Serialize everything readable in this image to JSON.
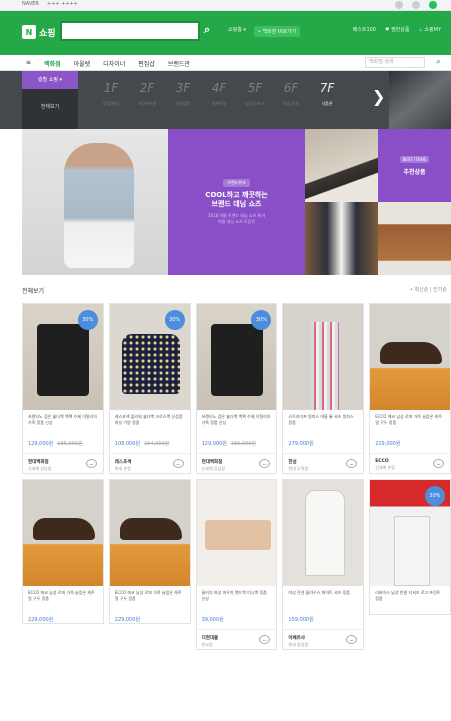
{
  "topbar": {
    "left_items": [
      "NAVER",
      "+++ ++++"
    ]
  },
  "header": {
    "logo_badge": "N",
    "logo_text": "쇼핑",
    "search_placeholder": "",
    "search_icon": "search-icon",
    "links": [
      "쇼핑홈 ▾",
      "• 백화점 바로가기"
    ],
    "right_links": [
      "베스트100",
      "♥ 찜한상품",
      "⊥ 쇼핑MY"
    ]
  },
  "catnav": {
    "items": [
      "≡",
      "백화점",
      "아울렛",
      "디자이너",
      "편집샵",
      "브랜드관"
    ],
    "search_placeholder": "백화점 검색"
  },
  "floorbar": {
    "tag": "층별 쇼핑 ▾",
    "current": "전체보기",
    "floors": [
      {
        "n": "1F",
        "s": "명품/화장"
      },
      {
        "n": "2F",
        "s": "여성캐주얼"
      },
      {
        "n": "3F",
        "s": "여성정장"
      },
      {
        "n": "4F",
        "s": "영캐주얼"
      },
      {
        "n": "5F",
        "s": "남성/스포츠"
      },
      {
        "n": "6F",
        "s": "아동/가정"
      },
      {
        "n": "7F",
        "s": "식품관"
      }
    ],
    "arrow": "❯"
  },
  "banner": {
    "label": "브랜드위크",
    "title": "COOL하고 깨끗하는\n브랜드 데님 쇼츠",
    "sub": "2018 여름 트렌드 데님 쇼츠 특가\n여름 데님 쇼츠 모음전",
    "rec_label": "BEST ITEMS",
    "rec_title": "추천상품"
  },
  "section": {
    "title": "전체보기",
    "sort": "• 최신순 | 인기순"
  },
  "columns": [
    [
      {
        "img": "img-bag",
        "badge": "30%",
        "text": "쏘렌티노 검은 숄더백 백팩 수제 이탈리아 가죽 정품 신상",
        "price": "129,000원",
        "orig": "185,000원",
        "shop": "현대백화점",
        "shop_sub": "신세계 강남점"
      },
      {
        "img": "img-shoe",
        "badge": "",
        "text": "ECCO 에코 남성 로퍼 가죽 슬립온 캐주얼 구두 정품",
        "price": "229,000원",
        "orig": "",
        "shop": "",
        "shop_sub": ""
      }
    ],
    [
      {
        "img": "img-floral",
        "badge": "30%",
        "text": "레스포색 플라워 숄더백 크로스백 신상품 여성 가방 정품",
        "price": "108,000원",
        "orig": "154,000원",
        "shop": "레스포색",
        "shop_sub": "롯데 본점"
      },
      {
        "img": "img-shoe",
        "badge": "",
        "text": "ECCO 에코 남성 로퍼 가죽 슬립온 캐주얼 구두 정품",
        "price": "229,000원",
        "orig": "",
        "shop": "",
        "shop_sub": ""
      }
    ],
    [
      {
        "img": "img-bag",
        "badge": "30%",
        "text": "쏘렌티노 검은 숄더백 백팩 수제 이탈리아 가죽 정품 신상",
        "price": "129,000원",
        "orig": "185,000원",
        "shop": "현대백화점",
        "shop_sub": "신세계 강남점"
      },
      {
        "img": "img-clutch",
        "badge": "",
        "text": "클러치 여성 파우치 핸드백 미니백 정품 신상",
        "price": "39,000원",
        "orig": "",
        "shop": "더현대몰",
        "shop_sub": "판교점"
      }
    ],
    [
      {
        "img": "img-skirt",
        "badge": "",
        "text": "스트라이프 원피스 여름 롱 셔츠 원피스 정품",
        "price": "279,000원",
        "orig": "",
        "shop": "한섬",
        "shop_sub": "현대 무역점"
      },
      {
        "img": "img-blouse",
        "badge": "",
        "text": "여성 린넨 블라우스 화이트 셔츠 정품",
        "price": "159,000원",
        "orig": "",
        "shop": "아페르샤",
        "shop_sub": "롯데 잠실점"
      }
    ],
    [
      {
        "img": "img-shoe",
        "badge": "",
        "text": "ECCO 에코 남성 로퍼 가죽 슬립온 캐주얼 구두 정품",
        "price": "229,000원",
        "orig": "",
        "shop": "ECCO",
        "shop_sub": "신세계 본점"
      },
      {
        "img": "img-levis",
        "badge": "30%",
        "text": "리바이스 남성 반팔 티셔츠 로고 프린트 정품",
        "price": "",
        "orig": "",
        "shop": "",
        "shop_sub": ""
      }
    ]
  ],
  "colors": {
    "brand": "#25a948",
    "purple": "#8a4fc6",
    "dark": "#45484d",
    "price": "#3d7fd4"
  }
}
